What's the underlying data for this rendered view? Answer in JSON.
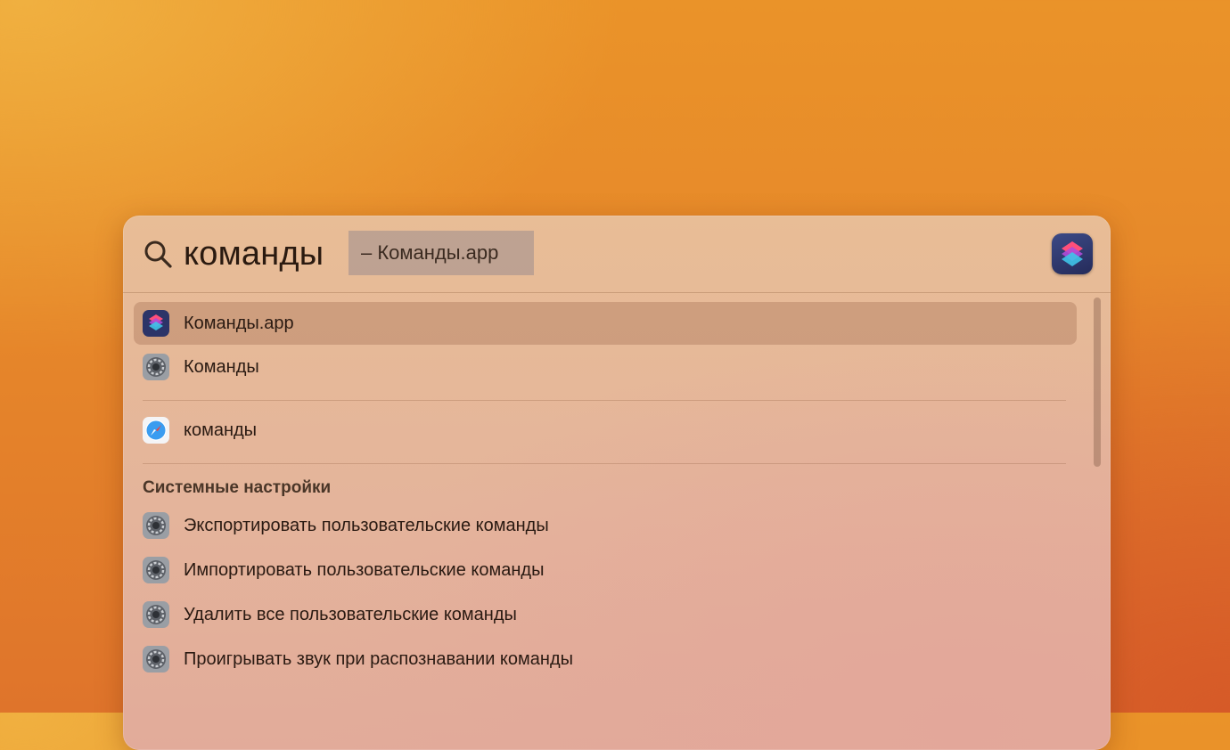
{
  "search": {
    "query": "команды",
    "completion": "– Команды.app"
  },
  "results": {
    "top_hits": [
      {
        "label": "Команды.app",
        "icon": "shortcuts-app-icon",
        "selected": true
      },
      {
        "label": "Команды",
        "icon": "system-settings-icon",
        "selected": false
      }
    ],
    "web": [
      {
        "label": "команды",
        "icon": "safari-icon",
        "selected": false
      }
    ],
    "system_settings": {
      "title": "Системные настройки",
      "items": [
        {
          "label": "Экспортировать пользовательские команды",
          "icon": "system-settings-icon"
        },
        {
          "label": "Импортировать пользовательские команды",
          "icon": "system-settings-icon"
        },
        {
          "label": "Удалить все пользовательские команды",
          "icon": "system-settings-icon"
        },
        {
          "label": "Проигрывать звук при распознавании команды",
          "icon": "system-settings-icon"
        }
      ]
    }
  },
  "colors": {
    "desktop_top": "#ea9329",
    "desktop_bottom": "#df742b",
    "panel": "#e8bd96",
    "selection": "#c89e7e",
    "completion_highlight": "#a8958f"
  }
}
